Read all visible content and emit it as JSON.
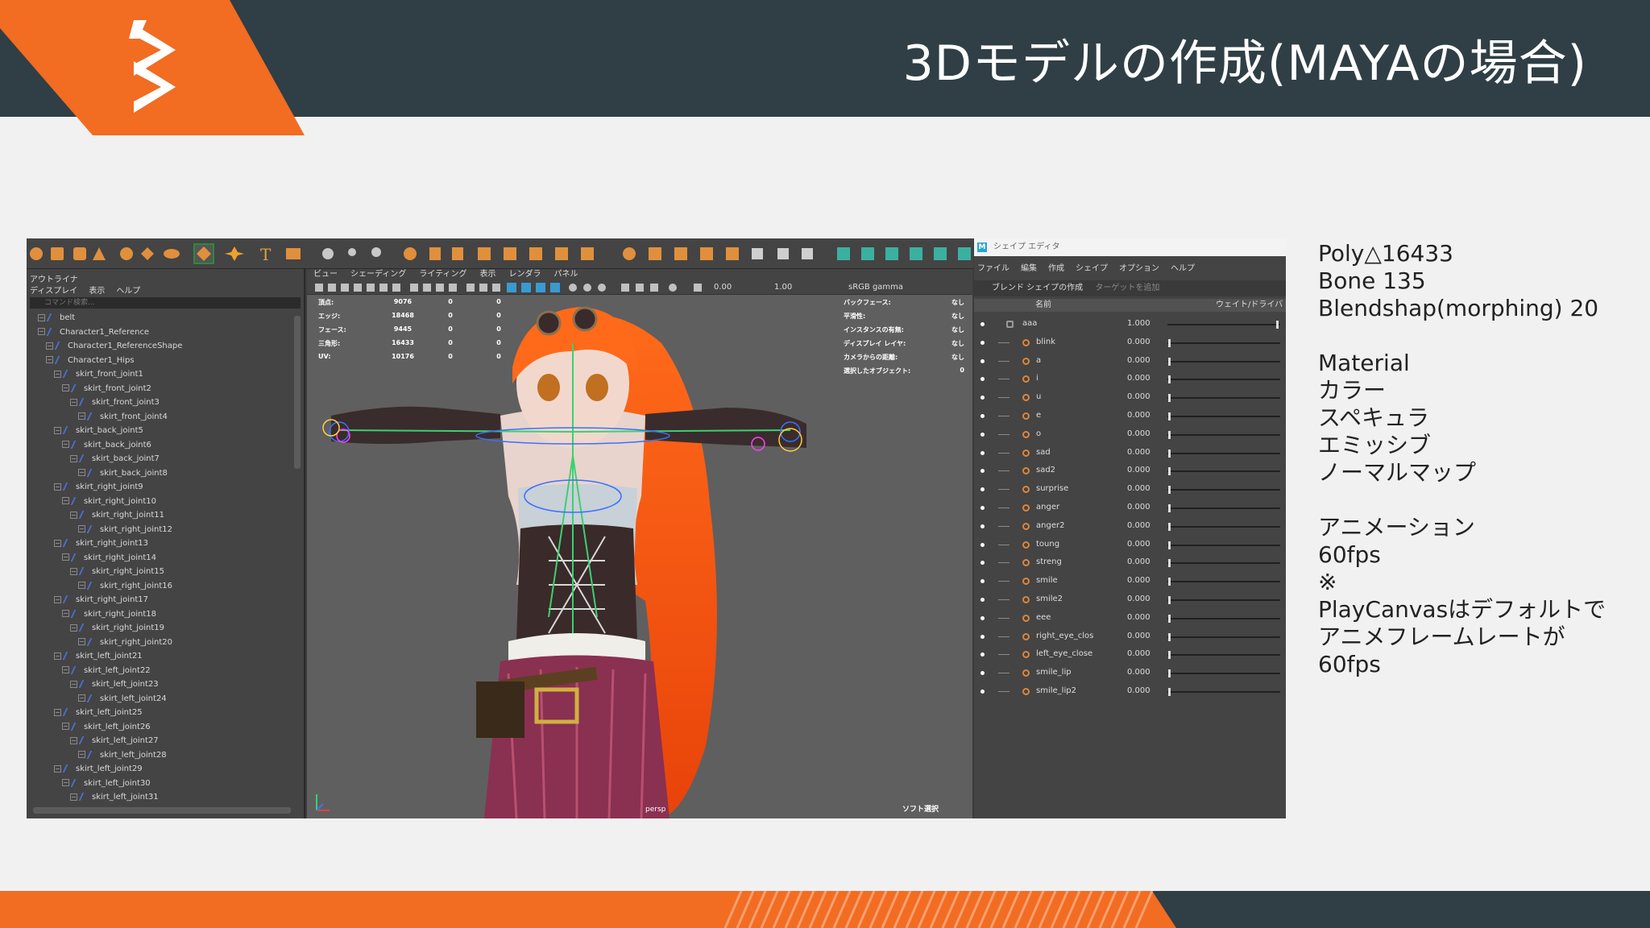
{
  "slide": {
    "title": "3Dモデルの作成(MAYAの場合)",
    "brand_color": "#f26c22",
    "header_color": "#2f3f45"
  },
  "outliner": {
    "title": "アウトライナ",
    "menu": [
      "ディスプレイ",
      "表示",
      "ヘルプ"
    ],
    "search_placeholder": "コマンド検索...",
    "items": [
      {
        "label": "belt",
        "depth": 0
      },
      {
        "label": "Character1_Reference",
        "depth": 0
      },
      {
        "label": "Character1_ReferenceShape",
        "depth": 1
      },
      {
        "label": "Character1_Hips",
        "depth": 1
      },
      {
        "label": "skirt_front_joint1",
        "depth": 2
      },
      {
        "label": "skirt_front_joint2",
        "depth": 3
      },
      {
        "label": "skirt_front_joint3",
        "depth": 4
      },
      {
        "label": "skirt_front_joint4",
        "depth": 5
      },
      {
        "label": "skirt_back_joint5",
        "depth": 2
      },
      {
        "label": "skirt_back_joint6",
        "depth": 3
      },
      {
        "label": "skirt_back_joint7",
        "depth": 4
      },
      {
        "label": "skirt_back_joint8",
        "depth": 5
      },
      {
        "label": "skirt_right_joint9",
        "depth": 2
      },
      {
        "label": "skirt_right_joint10",
        "depth": 3
      },
      {
        "label": "skirt_right_joint11",
        "depth": 4
      },
      {
        "label": "skirt_right_joint12",
        "depth": 5
      },
      {
        "label": "skirt_right_joint13",
        "depth": 2
      },
      {
        "label": "skirt_right_joint14",
        "depth": 3
      },
      {
        "label": "skirt_right_joint15",
        "depth": 4
      },
      {
        "label": "skirt_right_joint16",
        "depth": 5
      },
      {
        "label": "skirt_right_joint17",
        "depth": 2
      },
      {
        "label": "skirt_right_joint18",
        "depth": 3
      },
      {
        "label": "skirt_right_joint19",
        "depth": 4
      },
      {
        "label": "skirt_right_joint20",
        "depth": 5
      },
      {
        "label": "skirt_left_joint21",
        "depth": 2
      },
      {
        "label": "skirt_left_joint22",
        "depth": 3
      },
      {
        "label": "skirt_left_joint23",
        "depth": 4
      },
      {
        "label": "skirt_left_joint24",
        "depth": 5
      },
      {
        "label": "skirt_left_joint25",
        "depth": 2
      },
      {
        "label": "skirt_left_joint26",
        "depth": 3
      },
      {
        "label": "skirt_left_joint27",
        "depth": 4
      },
      {
        "label": "skirt_left_joint28",
        "depth": 5
      },
      {
        "label": "skirt_left_joint29",
        "depth": 2
      },
      {
        "label": "skirt_left_joint30",
        "depth": 3
      },
      {
        "label": "skirt_left_joint31",
        "depth": 4
      }
    ]
  },
  "viewport": {
    "menu": [
      "ビュー",
      "シェーディング",
      "ライティング",
      "表示",
      "レンダラ",
      "パネル"
    ],
    "field_a": "0.00",
    "field_b": "1.00",
    "color_space": "sRGB gamma",
    "hud_left": [
      {
        "label": "頂点:",
        "v1": "9076",
        "v2": "0",
        "v3": "0"
      },
      {
        "label": "エッジ:",
        "v1": "18468",
        "v2": "0",
        "v3": "0"
      },
      {
        "label": "フェース:",
        "v1": "9445",
        "v2": "0",
        "v3": "0"
      },
      {
        "label": "三角形:",
        "v1": "16433",
        "v2": "0",
        "v3": "0"
      },
      {
        "label": "UV:",
        "v1": "10176",
        "v2": "0",
        "v3": "0"
      }
    ],
    "hud_right": [
      {
        "label": "バックフェース:",
        "value": "なし"
      },
      {
        "label": "平滑性:",
        "value": "なし"
      },
      {
        "label": "インスタンスの有無:",
        "value": "なし"
      },
      {
        "label": "ディスプレイ レイヤ:",
        "value": "なし"
      },
      {
        "label": "カメラからの距離:",
        "value": "なし"
      },
      {
        "label": "選択したオブジェクト:",
        "value": "0"
      }
    ],
    "camera": "persp",
    "soft_select": "ソフト選択"
  },
  "shape_editor": {
    "title": "シェイプ エディタ",
    "menu": [
      "ファイル",
      "編集",
      "作成",
      "シェイプ",
      "オプション",
      "ヘルプ"
    ],
    "create_label": "ブレンド シェイプの作成",
    "add_target_label": "ターゲットを追加",
    "col_name": "名前",
    "col_weight": "ウェイト/ドライバ",
    "root": {
      "name": "aaa",
      "value": "1.000"
    },
    "targets": [
      {
        "name": "blink",
        "value": "0.000"
      },
      {
        "name": "a",
        "value": "0.000"
      },
      {
        "name": "i",
        "value": "0.000"
      },
      {
        "name": "u",
        "value": "0.000"
      },
      {
        "name": "e",
        "value": "0.000"
      },
      {
        "name": "o",
        "value": "0.000"
      },
      {
        "name": "sad",
        "value": "0.000"
      },
      {
        "name": "sad2",
        "value": "0.000"
      },
      {
        "name": "surprise",
        "value": "0.000"
      },
      {
        "name": "anger",
        "value": "0.000"
      },
      {
        "name": "anger2",
        "value": "0.000"
      },
      {
        "name": "toung",
        "value": "0.000"
      },
      {
        "name": "streng",
        "value": "0.000"
      },
      {
        "name": "smile",
        "value": "0.000"
      },
      {
        "name": "smile2",
        "value": "0.000"
      },
      {
        "name": "eee",
        "value": "0.000"
      },
      {
        "name": "right_eye_clos",
        "value": "0.000"
      },
      {
        "name": "left_eye_close",
        "value": "0.000"
      },
      {
        "name": "smile_lip",
        "value": "0.000"
      },
      {
        "name": "smile_lip2",
        "value": "0.000"
      }
    ]
  },
  "notes": [
    "Poly△16433",
    "Bone 135",
    "Blendshap(morphing) 20",
    "",
    "Material",
    "カラー",
    "スペキュラ",
    "エミッシブ",
    "ノーマルマップ",
    "",
    "アニメーション",
    "60fps",
    "※",
    "PlayCanvasはデフォルトで",
    "アニメフレームレートが",
    "60fps"
  ]
}
